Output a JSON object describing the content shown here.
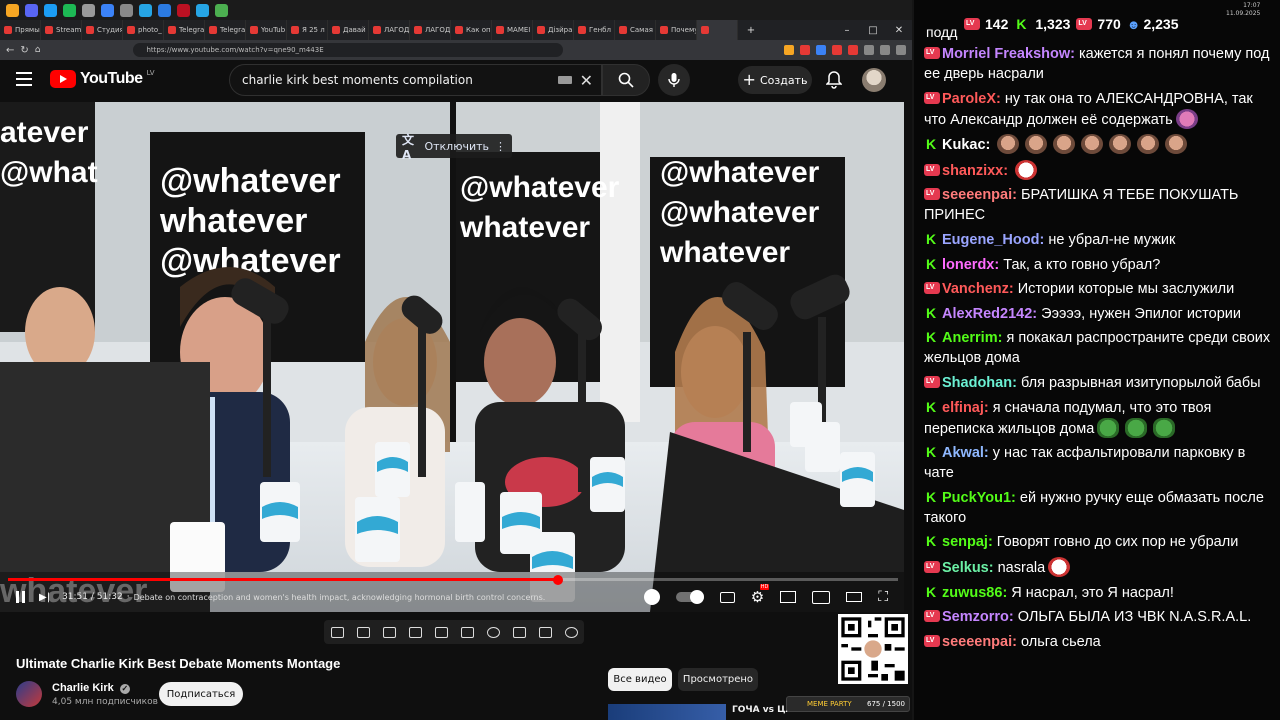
{
  "taskbar": {
    "icons": [
      "#f6a623",
      "#5865f2",
      "#1b9cf2",
      "#1db954",
      "#999",
      "#3b82f6",
      "#888",
      "#26a5e4",
      "#2b7ae1",
      "#b12",
      "#26a5e4",
      "#4caf50"
    ]
  },
  "browser": {
    "tabs": [
      {
        "label": "Прямые",
        "active": false
      },
      {
        "label": "Stream",
        "active": false
      },
      {
        "label": "Студия",
        "active": false
      },
      {
        "label": "photo_",
        "active": false
      },
      {
        "label": "Telegra",
        "active": false
      },
      {
        "label": "Telegra",
        "active": false
      },
      {
        "label": "YouTub",
        "active": false
      },
      {
        "label": "Я 25 л",
        "active": false
      },
      {
        "label": "Давай",
        "active": false
      },
      {
        "label": "ЛАГОД",
        "active": false
      },
      {
        "label": "ЛАГОД",
        "active": false
      },
      {
        "label": "Как оп",
        "active": false
      },
      {
        "label": "MAMEI",
        "active": false
      },
      {
        "label": "Дізйра",
        "active": false
      },
      {
        "label": "Генбл",
        "active": false
      },
      {
        "label": "Самая",
        "active": false
      },
      {
        "label": "Почему",
        "active": false
      },
      {
        "label": "",
        "active": true
      }
    ],
    "url": "https://www.youtube.com/watch?v=qne90_m443E"
  },
  "youtube": {
    "logo_text": "YouTube",
    "logo_region": "LV",
    "search_query": "charlie kirk best moments compilation",
    "create_label": "Создать",
    "caption_toggle_label": "Отключить",
    "player": {
      "time": "31:51 / 51:32",
      "chapter": "Debate on contraception and women's health impact, acknowledging hormonal birth control concerns.",
      "progress": 0.618,
      "settings_badge": "HD",
      "watermark": "whatever"
    },
    "video_title": "Ultimate Charlie Kirk Best Debate Moments Montage",
    "channel_name": "Charlie Kirk",
    "channel_subs": "4,05 млн подписчиков",
    "subscribe_label": "Подписаться",
    "chips": [
      "Все видео",
      "Просмотрено"
    ],
    "rec_title": "ГОЧА vs ЦАР",
    "meme_party": {
      "label": "MEME PARTY",
      "count": "675 / 1500"
    }
  },
  "chat": {
    "stats": {
      "lv_viewers": "142",
      "kick_viewers": "1,323",
      "lv_followers": "770",
      "total": "2,235"
    },
    "clock": {
      "time": "17:07",
      "date": "11.09.2025"
    },
    "top_partial": "подд",
    "messages": [
      {
        "platform": "lv",
        "user": "Morriel Freakshow",
        "color": "#c586ff",
        "text": "кажется я понял почему под ее дверь насрали",
        "emotes": []
      },
      {
        "platform": "lv",
        "user": "ParoleX",
        "color": "#ff5a5a",
        "text": "ну так она то АЛЕКСАНДРОВНА, так что Александр должен её содержать",
        "emotes": [
          "pig"
        ]
      },
      {
        "platform": "k",
        "user": "Kukac",
        "color": "#fff",
        "text": "",
        "emotes": [
          "face",
          "face",
          "face",
          "face",
          "face",
          "face",
          "face"
        ]
      },
      {
        "platform": "lv",
        "user": "shanzixx",
        "color": "#ff5a5a",
        "text": "",
        "emotes": [
          "ghost"
        ]
      },
      {
        "platform": "lv",
        "user": "seeeenpai",
        "color": "#ff7b7b",
        "text": "БРАТИШКА Я ТЕБЕ ПОКУШАТЬ ПРИНЕС",
        "emotes": []
      },
      {
        "platform": "k",
        "user": "Eugene_Hood",
        "color": "#9aa5ff",
        "text": "не убрал-не мужик",
        "emotes": []
      },
      {
        "platform": "k",
        "user": "lonerdx",
        "color": "#ff6bff",
        "text": "Так, а кто говно убрал?",
        "emotes": []
      },
      {
        "platform": "lv",
        "user": "Vanchenz",
        "color": "#ff5a5a",
        "text": "Истории которые мы заслужили",
        "emotes": []
      },
      {
        "platform": "k",
        "user": "AlexRed2142",
        "color": "#c586ff",
        "text": "Эээээ, нужен Эпилог истории",
        "emotes": []
      },
      {
        "platform": "k",
        "user": "Anerrim",
        "color": "#53fc18",
        "text": "я покакал распространите среди своих жельцов дома",
        "emotes": []
      },
      {
        "platform": "lv",
        "user": "Shadohan",
        "color": "#6bf0d3",
        "text": "бля разрывная изитупорылой бабы",
        "emotes": []
      },
      {
        "platform": "k",
        "user": "elfinaj",
        "color": "#ff5a5a",
        "text": "я сначала подумал, что это твоя переписка жильцов дома",
        "emotes": [
          "frog",
          "frog",
          "frog"
        ]
      },
      {
        "platform": "k",
        "user": "Akwal",
        "color": "#8fb8ff",
        "text": "у нас так асфальтировали парковку в чате",
        "emotes": []
      },
      {
        "platform": "k",
        "user": "PuckYou1",
        "color": "#53fc18",
        "text": "ей нужно ручку еще обмазать после такого",
        "emotes": []
      },
      {
        "platform": "k",
        "user": "senpaj",
        "color": "#53fc18",
        "text": "Говорят говно до сих пор не убрали",
        "emotes": []
      },
      {
        "platform": "lv",
        "user": "Selkus",
        "color": "#6bf0a5",
        "text": "nasrala",
        "emotes": [
          "ghost"
        ]
      },
      {
        "platform": "k",
        "user": "zuwus86",
        "color": "#53fc18",
        "text": "Я насрал, это Я насрал!",
        "emotes": []
      },
      {
        "platform": "lv",
        "user": "Semzorro",
        "color": "#c586ff",
        "text": "ОЛЬГА БЫЛА ИЗ ЧВК N.A.S.R.A.L.",
        "emotes": []
      },
      {
        "platform": "lv",
        "user": "seeeenpai",
        "color": "#ff7b7b",
        "text": "ольга сьела",
        "emotes": []
      }
    ]
  }
}
